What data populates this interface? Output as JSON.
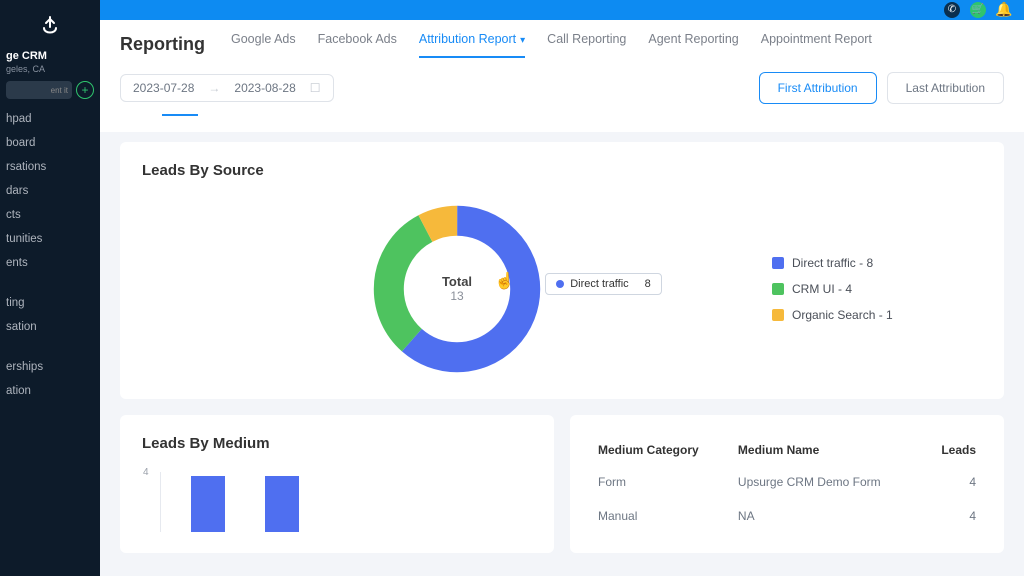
{
  "colors": {
    "blue": "#4f6ff0",
    "green": "#4ec35f",
    "yellow": "#f6b93b"
  },
  "org": {
    "name": "ge CRM",
    "location": "geles, CA",
    "search_placeholder": "ent it"
  },
  "sidebar": {
    "group1": [
      "hpad",
      "board",
      "rsations",
      "dars",
      "cts",
      "tunities",
      "ents"
    ],
    "group2": [
      "ting",
      "sation"
    ],
    "group3": [
      "erships",
      "ation"
    ]
  },
  "header": {
    "title": "Reporting",
    "tabs": [
      {
        "label": "Google Ads",
        "active": false
      },
      {
        "label": "Facebook Ads",
        "active": false
      },
      {
        "label": "Attribution Report",
        "active": true,
        "chevron": true
      },
      {
        "label": "Call Reporting",
        "active": false
      },
      {
        "label": "Agent Reporting",
        "active": false
      },
      {
        "label": "Appointment Report",
        "active": false
      }
    ]
  },
  "date_range": {
    "from": "2023-07-28",
    "to": "2023-08-28"
  },
  "attribution_buttons": {
    "first": "First Attribution",
    "last": "Last Attribution"
  },
  "leads_by_source": {
    "title": "Leads By Source",
    "center_label": "Total",
    "center_value": "13",
    "tooltip": {
      "label": "Direct traffic",
      "value": "8",
      "color": "blue"
    },
    "legend": [
      {
        "label": "Direct traffic - 8",
        "color": "blue"
      },
      {
        "label": "CRM UI - 4",
        "color": "green"
      },
      {
        "label": "Organic Search - 1",
        "color": "yellow"
      }
    ]
  },
  "leads_by_medium": {
    "title": "Leads By Medium",
    "y_tick": "4"
  },
  "medium_table": {
    "headers": [
      "Medium Category",
      "Medium Name",
      "Leads"
    ],
    "rows": [
      {
        "category": "Form",
        "name": "Upsurge CRM Demo Form",
        "leads": "4"
      },
      {
        "category": "Manual",
        "name": "NA",
        "leads": "4"
      }
    ]
  },
  "chart_data": [
    {
      "type": "pie",
      "title": "Leads By Source",
      "categories": [
        "Direct traffic",
        "CRM UI",
        "Organic Search"
      ],
      "values": [
        8,
        4,
        1
      ],
      "total": 13
    },
    {
      "type": "bar",
      "title": "Leads By Medium",
      "categories": [
        "Form",
        "Manual"
      ],
      "values": [
        4,
        4
      ],
      "ylim": [
        0,
        4
      ]
    }
  ]
}
